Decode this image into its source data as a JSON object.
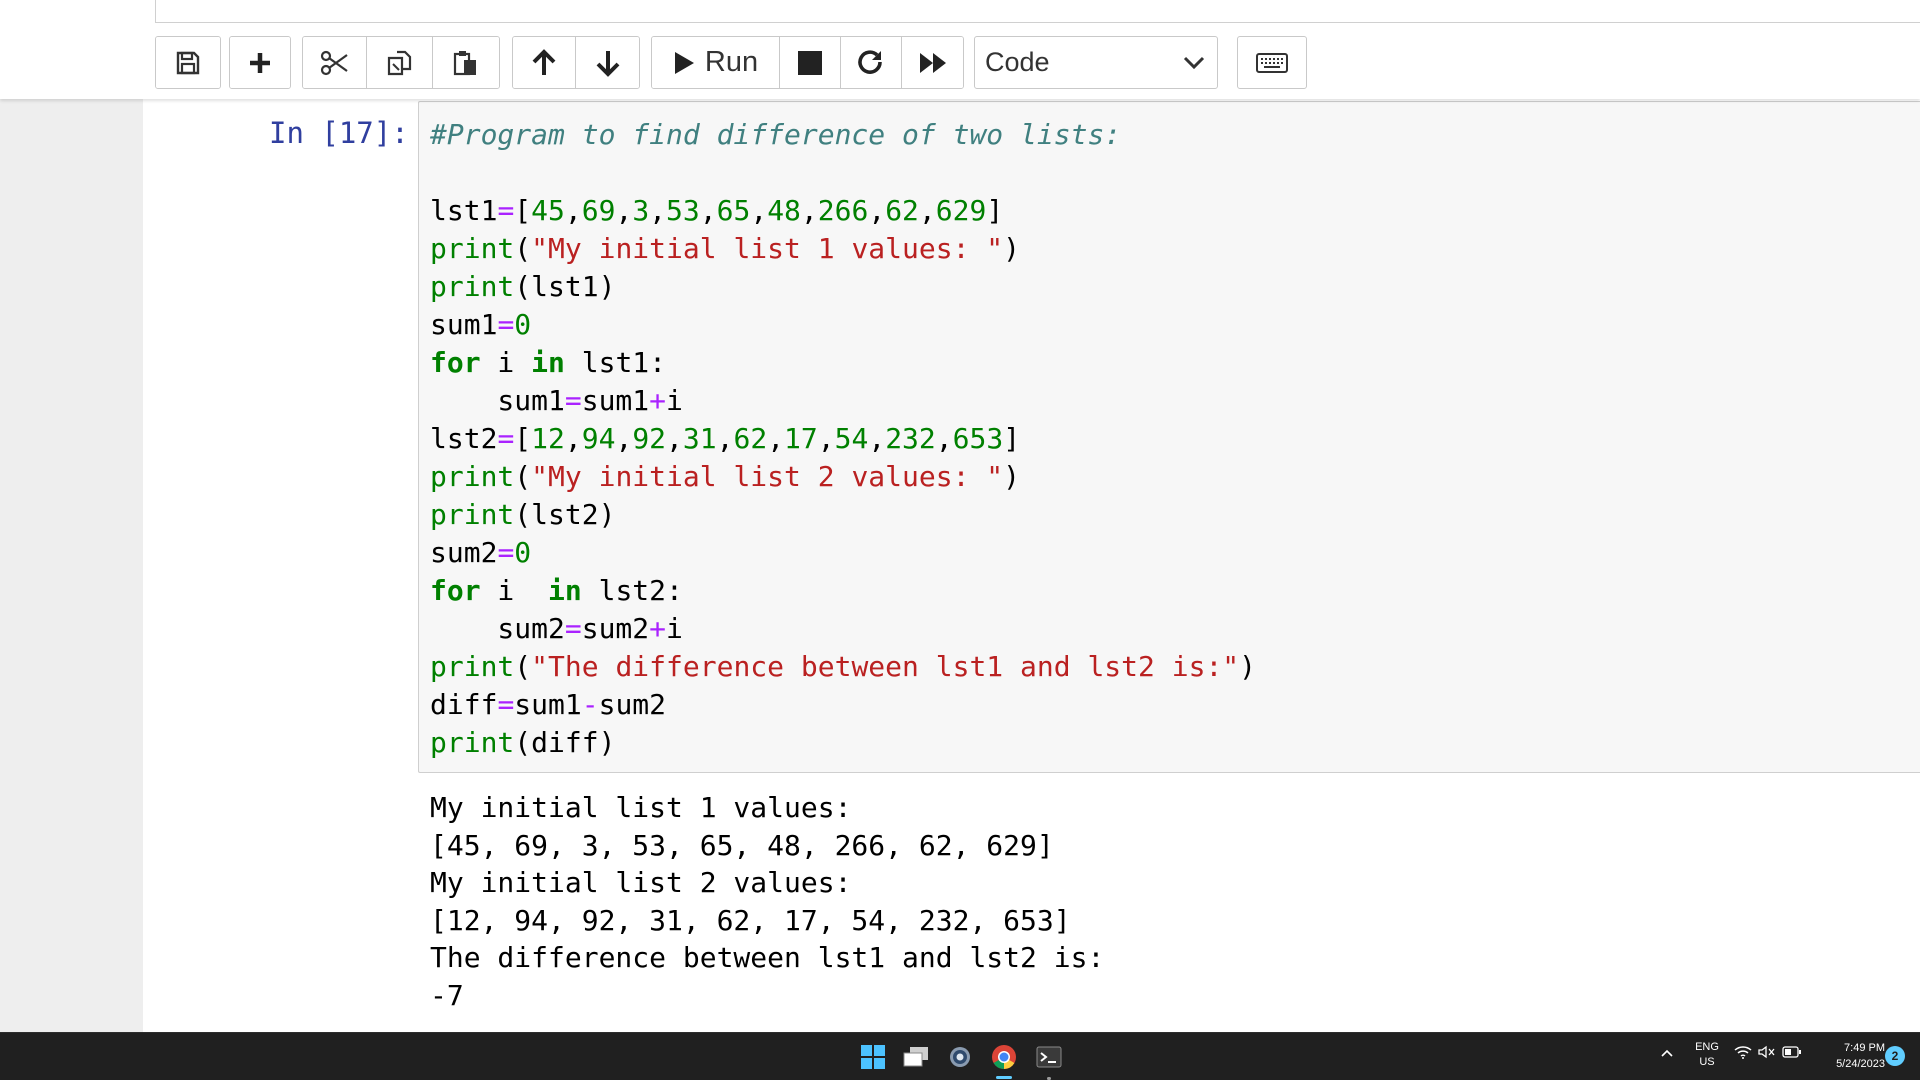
{
  "toolbar": {
    "run_label": "Run",
    "cell_type": "Code"
  },
  "cell": {
    "prompt": "In [17]:",
    "code_lines": [
      [
        {
          "t": "#Program to find difference of two lists:",
          "k": "comment"
        }
      ],
      [],
      [
        {
          "t": "lst1",
          "k": "name"
        },
        {
          "t": "=",
          "k": "op"
        },
        {
          "t": "[",
          "k": "name"
        },
        {
          "t": "45",
          "k": "number"
        },
        {
          "t": ",",
          "k": "name"
        },
        {
          "t": "69",
          "k": "number"
        },
        {
          "t": ",",
          "k": "name"
        },
        {
          "t": "3",
          "k": "number"
        },
        {
          "t": ",",
          "k": "name"
        },
        {
          "t": "53",
          "k": "number"
        },
        {
          "t": ",",
          "k": "name"
        },
        {
          "t": "65",
          "k": "number"
        },
        {
          "t": ",",
          "k": "name"
        },
        {
          "t": "48",
          "k": "number"
        },
        {
          "t": ",",
          "k": "name"
        },
        {
          "t": "266",
          "k": "number"
        },
        {
          "t": ",",
          "k": "name"
        },
        {
          "t": "62",
          "k": "number"
        },
        {
          "t": ",",
          "k": "name"
        },
        {
          "t": "629",
          "k": "number"
        },
        {
          "t": "]",
          "k": "name"
        }
      ],
      [
        {
          "t": "print",
          "k": "builtin"
        },
        {
          "t": "(",
          "k": "name"
        },
        {
          "t": "\"My initial list 1 values: \"",
          "k": "string"
        },
        {
          "t": ")",
          "k": "name"
        }
      ],
      [
        {
          "t": "print",
          "k": "builtin"
        },
        {
          "t": "(lst1)",
          "k": "name"
        }
      ],
      [
        {
          "t": "sum1",
          "k": "name"
        },
        {
          "t": "=",
          "k": "op"
        },
        {
          "t": "0",
          "k": "number"
        }
      ],
      [
        {
          "t": "for",
          "k": "keyword"
        },
        {
          "t": " i ",
          "k": "name"
        },
        {
          "t": "in",
          "k": "keyword"
        },
        {
          "t": " lst1:",
          "k": "name"
        }
      ],
      [
        {
          "t": "    sum1",
          "k": "name"
        },
        {
          "t": "=",
          "k": "op"
        },
        {
          "t": "sum1",
          "k": "name"
        },
        {
          "t": "+",
          "k": "op"
        },
        {
          "t": "i",
          "k": "name"
        }
      ],
      [
        {
          "t": "lst2",
          "k": "name"
        },
        {
          "t": "=",
          "k": "op"
        },
        {
          "t": "[",
          "k": "name"
        },
        {
          "t": "12",
          "k": "number"
        },
        {
          "t": ",",
          "k": "name"
        },
        {
          "t": "94",
          "k": "number"
        },
        {
          "t": ",",
          "k": "name"
        },
        {
          "t": "92",
          "k": "number"
        },
        {
          "t": ",",
          "k": "name"
        },
        {
          "t": "31",
          "k": "number"
        },
        {
          "t": ",",
          "k": "name"
        },
        {
          "t": "62",
          "k": "number"
        },
        {
          "t": ",",
          "k": "name"
        },
        {
          "t": "17",
          "k": "number"
        },
        {
          "t": ",",
          "k": "name"
        },
        {
          "t": "54",
          "k": "number"
        },
        {
          "t": ",",
          "k": "name"
        },
        {
          "t": "232",
          "k": "number"
        },
        {
          "t": ",",
          "k": "name"
        },
        {
          "t": "653",
          "k": "number"
        },
        {
          "t": "]",
          "k": "name"
        }
      ],
      [
        {
          "t": "print",
          "k": "builtin"
        },
        {
          "t": "(",
          "k": "name"
        },
        {
          "t": "\"My initial list 2 values: \"",
          "k": "string"
        },
        {
          "t": ")",
          "k": "name"
        }
      ],
      [
        {
          "t": "print",
          "k": "builtin"
        },
        {
          "t": "(lst2)",
          "k": "name"
        }
      ],
      [
        {
          "t": "sum2",
          "k": "name"
        },
        {
          "t": "=",
          "k": "op"
        },
        {
          "t": "0",
          "k": "number"
        }
      ],
      [
        {
          "t": "for",
          "k": "keyword"
        },
        {
          "t": " i  ",
          "k": "name"
        },
        {
          "t": "in",
          "k": "keyword"
        },
        {
          "t": " lst2:",
          "k": "name"
        }
      ],
      [
        {
          "t": "    sum2",
          "k": "name"
        },
        {
          "t": "=",
          "k": "op"
        },
        {
          "t": "sum2",
          "k": "name"
        },
        {
          "t": "+",
          "k": "op"
        },
        {
          "t": "i",
          "k": "name"
        }
      ],
      [
        {
          "t": "print",
          "k": "builtin"
        },
        {
          "t": "(",
          "k": "name"
        },
        {
          "t": "\"The difference between lst1 and lst2 is:\"",
          "k": "string"
        },
        {
          "t": ")",
          "k": "name"
        }
      ],
      [
        {
          "t": "diff",
          "k": "name"
        },
        {
          "t": "=",
          "k": "op"
        },
        {
          "t": "sum1",
          "k": "name"
        },
        {
          "t": "-",
          "k": "op"
        },
        {
          "t": "sum2",
          "k": "name"
        }
      ],
      [
        {
          "t": "print",
          "k": "builtin"
        },
        {
          "t": "(diff)",
          "k": "name"
        }
      ]
    ],
    "output_lines": [
      "My initial list 1 values: ",
      "[45, 69, 3, 53, 65, 48, 266, 62, 629]",
      "My initial list 2 values: ",
      "[12, 94, 92, 31, 62, 17, 54, 232, 653]",
      "The difference between lst1 and lst2 is:",
      "-7"
    ]
  },
  "taskbar": {
    "apps": [
      "windows-start-icon",
      "task-view-icon",
      "settings-icon",
      "chrome-icon",
      "terminal-icon"
    ],
    "language": {
      "line1": "ENG",
      "line2": "US"
    },
    "time": "7:49 PM",
    "date": "5/24/2023",
    "notification_count": "2"
  },
  "colors": {
    "comment": "#408080",
    "keyword": "#008000",
    "string": "#ba2121",
    "number": "#008000",
    "operator": "#aa22ff",
    "prompt": "#303f9f",
    "taskbar": "#202020"
  }
}
